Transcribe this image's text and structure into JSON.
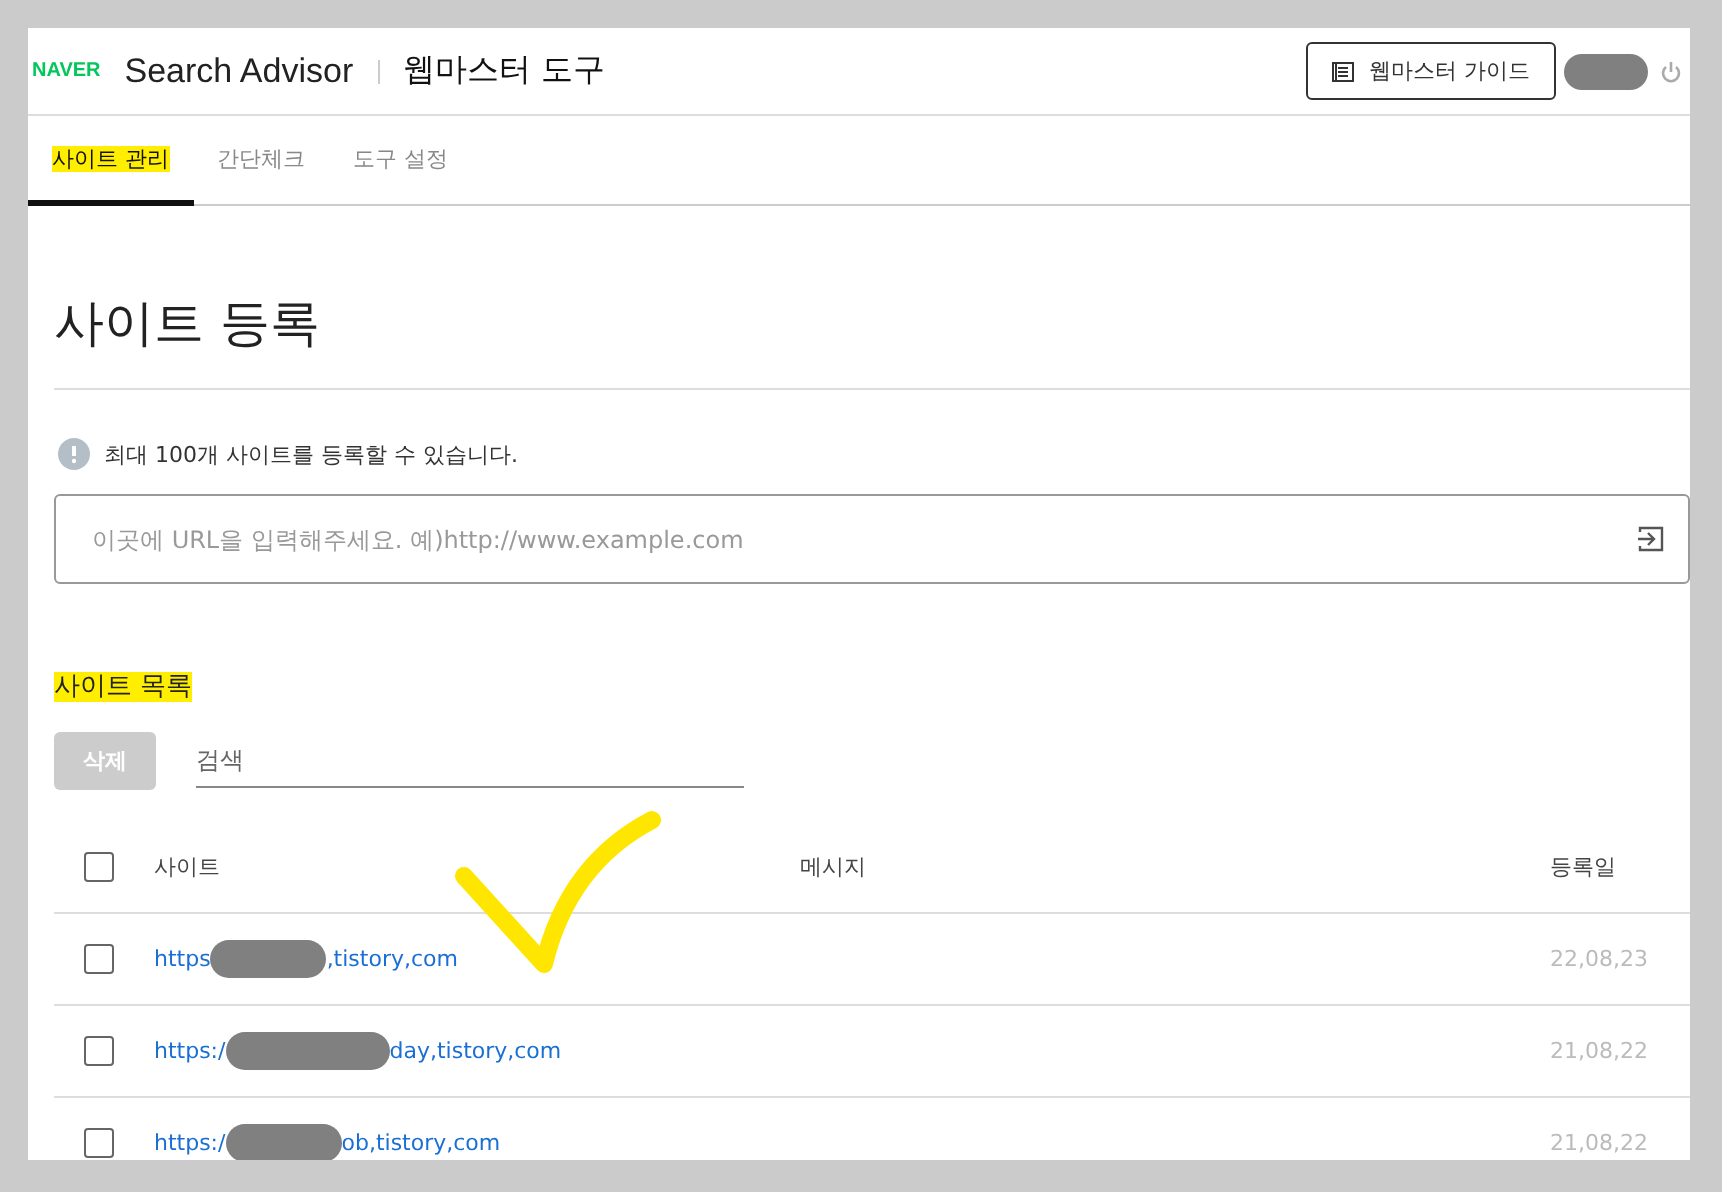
{
  "header": {
    "logo": "NAVER",
    "product": "Search Advisor",
    "section": "웹마스터 도구",
    "guide_button": "웹마스터 가이드"
  },
  "tabs": [
    {
      "label": "사이트 관리",
      "selected": true,
      "highlighted": true
    },
    {
      "label": "간단체크",
      "selected": false,
      "highlighted": false
    },
    {
      "label": "도구 설정",
      "selected": false,
      "highlighted": false
    }
  ],
  "register": {
    "title": "사이트 등록",
    "notice": "최대 100개 사이트를 등록할 수 있습니다.",
    "url_field": {
      "placeholder": "이곳에 URL을 입력해주세요. 예)http://www.example.com"
    }
  },
  "list": {
    "title": "사이트 목록",
    "title_highlighted": true,
    "delete_button": {
      "label": "삭제",
      "disabled": true
    },
    "search": {
      "placeholder": "검색"
    },
    "columns": [
      "사이트",
      "메시지",
      "등록일"
    ],
    "all_checked": false,
    "rows": [
      {
        "checked": false,
        "url_start": "https",
        "url_end": ",tistory,com",
        "date": "22,08,23"
      },
      {
        "checked": false,
        "url_start": "https:/",
        "url_end": "day,tistory,com",
        "date": "21,08,22"
      },
      {
        "checked": false,
        "url_start": "https:/",
        "url_end": "ob,tistory,com",
        "date": "21,08,22"
      }
    ]
  }
}
